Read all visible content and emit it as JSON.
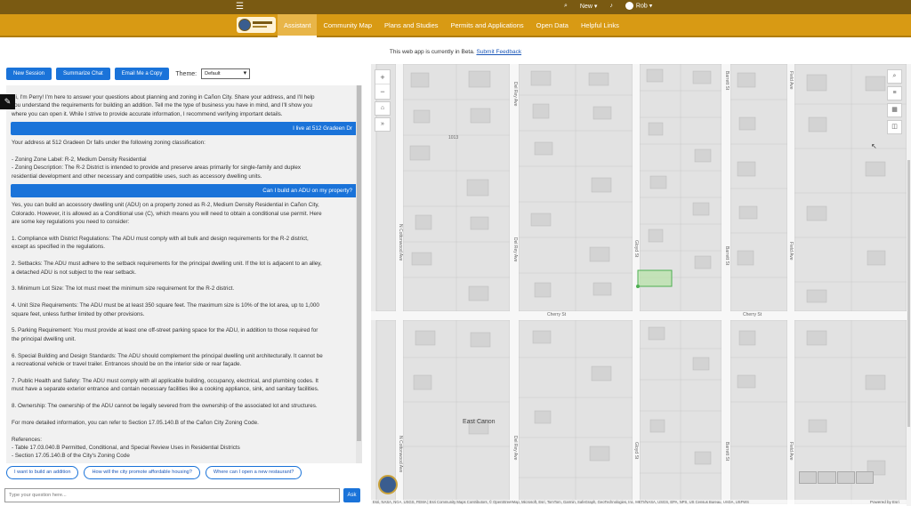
{
  "topbar": {
    "new_label": "New",
    "user_name": "Rob"
  },
  "nav": {
    "items": [
      "Assistant",
      "Community Map",
      "Plans and Studies",
      "Permits and Applications",
      "Open Data",
      "Helpful Links"
    ],
    "active": "Assistant"
  },
  "beta": {
    "text": "This web app is currently in Beta.",
    "link": "Submit Feedback"
  },
  "toolbar": {
    "new_session": "New Session",
    "summarize": "Summarize Chat",
    "email": "Email Me a Copy",
    "theme_label": "Theme:",
    "theme_value": "Default"
  },
  "chat": {
    "intro": [
      "Hi, I'm Perry! I'm here to answer your questions about planning and zoning in Cañon City. Share your address, and I'll help",
      "you understand the requirements for building an addition. Tell me the type of business you have in mind, and I'll show you",
      "where you can open it. While I strive to provide accurate information, I recommend verifying important details."
    ],
    "user_1": "I live at 512 Gradeen Dr",
    "reply_1": [
      "Your address at 512 Gradeen Dr falls under the following zoning classification:",
      "",
      "- Zoning Zone Label: R-2, Medium Density Residential",
      "- Zoning Description: The R-2 District is intended to provide and preserve areas primarily for single-family and duplex",
      "residential development and other necessary and compatible uses, such as accessory dwelling units."
    ],
    "user_2": "Can I build an ADU on my property?",
    "reply_2": [
      "Yes, you can build an accessory dwelling unit (ADU) on a property zoned as R-2, Medium Density Residential in Cañon City,",
      "Colorado. However, it is allowed as a Conditional use (C), which means you will need to obtain a conditional use permit. Here",
      "are some key regulations you need to consider:",
      "",
      "1. Compliance with District Regulations: The ADU must comply with all bulk and design requirements for the R-2 district,",
      "except as specified in the regulations.",
      "",
      "2. Setbacks: The ADU must adhere to the setback requirements for the principal dwelling unit. If the lot is adjacent to an alley,",
      "a detached ADU is not subject to the rear setback.",
      "",
      "3. Minimum Lot Size: The lot must meet the minimum size requirement for the R-2 district.",
      "",
      "4. Unit Size Requirements: The ADU must be at least 350 square feet. The maximum size is 10% of the lot area, up to 1,000",
      "square feet, unless further limited by other provisions.",
      "",
      "5. Parking Requirement: You must provide at least one off-street parking space for the ADU, in addition to those required for",
      "the principal dwelling unit.",
      "",
      "6. Special Building and Design Standards: The ADU should complement the principal dwelling unit architecturally. It cannot be",
      "a recreational vehicle or travel trailer. Entrances should be on the interior side or rear façade.",
      "",
      "7. Public Health and Safety: The ADU must comply with all applicable building, occupancy, electrical, and plumbing codes. It",
      "must have a separate exterior entrance and contain necessary facilities like a cooking appliance, sink, and sanitary facilities.",
      "",
      "8. Ownership: The ownership of the ADU cannot be legally severed from the ownership of the associated lot and structures.",
      "",
      "For more detailed information, you can refer to Section 17.05.140.B of the Cañon City Zoning Code.",
      "",
      "References:",
      "- Table 17.03.040.B Permitted, Conditional, and Special Review Uses in Residential Districts",
      "- Section 17.05.140.B of the City's Zoning Code"
    ]
  },
  "suggestions": [
    "I want to build an addition",
    "How will the city promote affordable housing?",
    "Where can I open a new restaurant?"
  ],
  "input": {
    "placeholder": "Type your question here...",
    "ask_label": "Ask"
  },
  "map": {
    "labels": {
      "cottonwood": "N Cottonwood Ave",
      "del_rey": "Del Rey Ave",
      "gloyd": "Gloyd St",
      "barrett": "Barrett St",
      "field": "Field Ave",
      "cherry1": "Cherry St",
      "cherry2": "Cherry St",
      "east_canon": "East Canon",
      "number": "1013"
    },
    "attribution": "Esri, NASA, NGA, USGS, FEMA | Esri Community Maps Contributors, © OpenStreetMap, Microsoft, Esri, TomTom, Garmin, SafeGraph, GeoTechnologies, Inc, METI/NASA, USGS, EPA, NPS, US Census Bureau, USDA, USFWS",
    "powered": "Powered by Esri"
  }
}
